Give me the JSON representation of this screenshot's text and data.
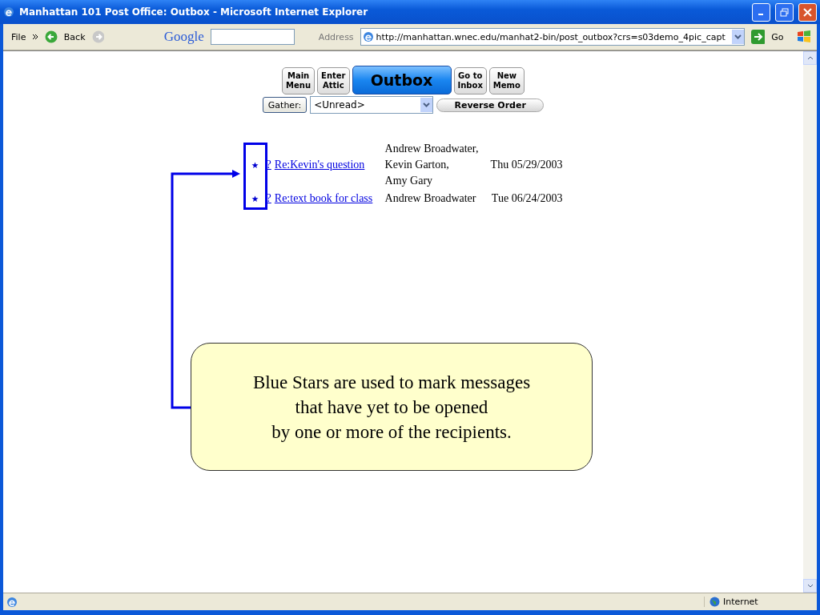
{
  "window": {
    "title": "Manhattan 101 Post Office: Outbox - Microsoft Internet Explorer"
  },
  "toolbar": {
    "menu": "File",
    "back": "Back",
    "search_brand": "Google",
    "address_label": "Address",
    "url": "http://manhattan.wnec.edu/manhat2-bin/post_outbox?crs=s03demo_4pic_capt",
    "go": "Go"
  },
  "nav_buttons": [
    {
      "lines": [
        "Main",
        "Menu"
      ],
      "selected": false
    },
    {
      "lines": [
        "Enter",
        "Attic"
      ],
      "selected": false
    },
    {
      "lines": [
        "Outbox"
      ],
      "selected": true
    },
    {
      "lines": [
        "Go to",
        "Inbox"
      ],
      "selected": false
    },
    {
      "lines": [
        "New",
        "Memo"
      ],
      "selected": false
    }
  ],
  "filter": {
    "gather": "Gather:",
    "value": "<Unread>",
    "reverse": "Reverse Order"
  },
  "messages": [
    {
      "unread": true,
      "flag": "?",
      "subject": "Re:Kevin's question",
      "recipients": [
        "Andrew Broadwater,",
        "Kevin Garton,",
        "Amy Gary"
      ],
      "date": "Thu 05/29/2003"
    },
    {
      "unread": true,
      "flag": "?",
      "subject": "Re:text book for class",
      "recipients": [
        "Andrew Broadwater"
      ],
      "date": "Tue 06/24/2003"
    }
  ],
  "callout": {
    "lines": [
      "Blue Stars are used to mark messages",
      "that have yet to be opened",
      "by one or more of the recipients."
    ]
  },
  "status_bar": {
    "zone": "Internet"
  }
}
